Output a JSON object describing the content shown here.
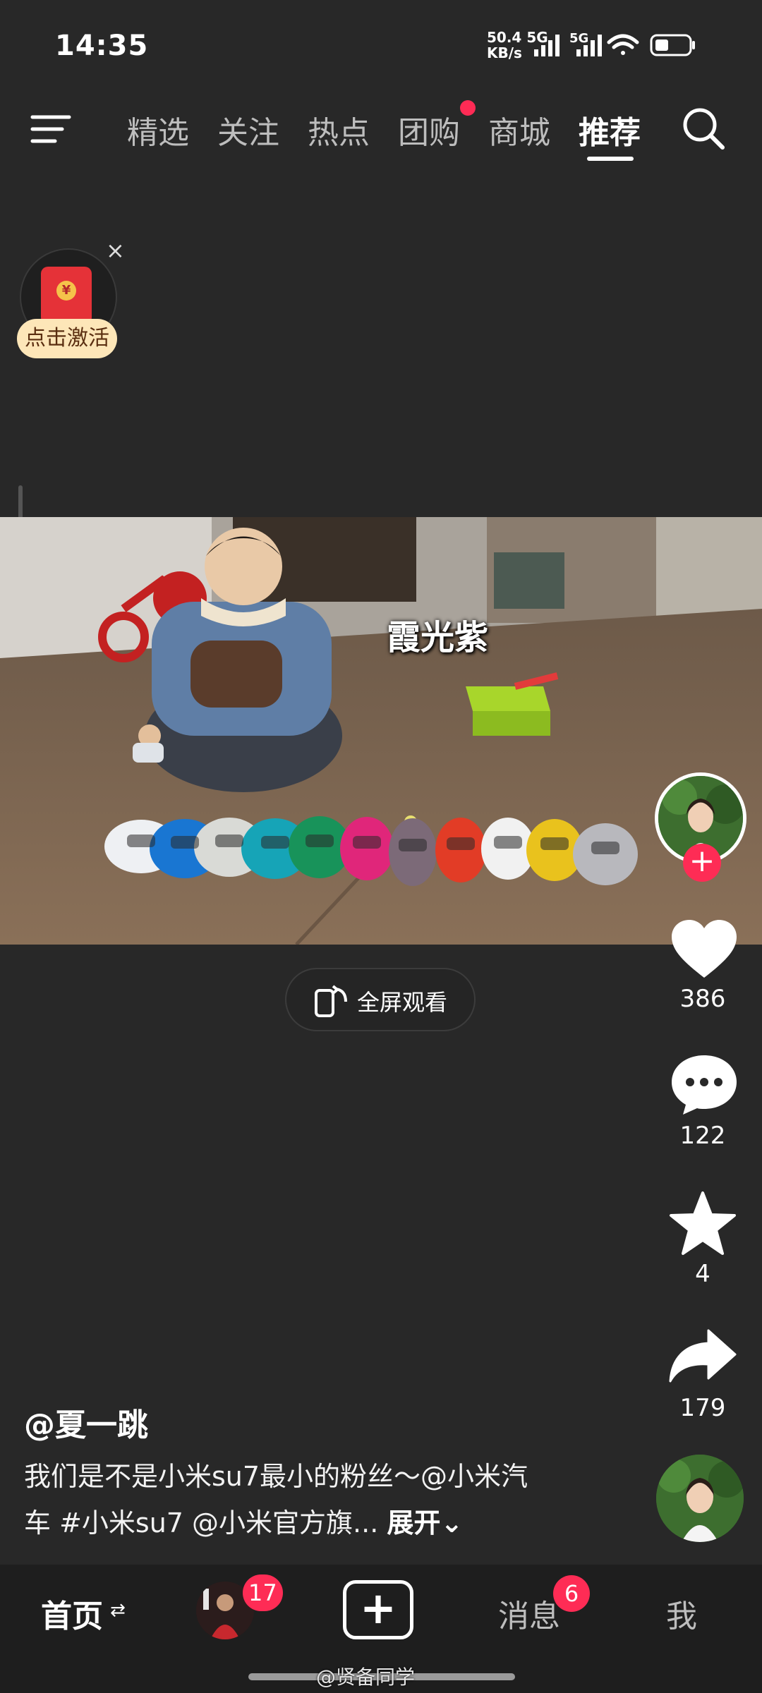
{
  "status_bar": {
    "time": "14:35",
    "speed_value": "50.4",
    "speed_unit": "KB/s",
    "network1": "5G",
    "network2": "5G"
  },
  "top_nav": {
    "tabs": [
      "精选",
      "关注",
      "热点",
      "团购",
      "商城",
      "推荐"
    ],
    "active_tab": "推荐",
    "icons": {
      "menu": "menu-icon",
      "search": "search-icon"
    }
  },
  "red_packet": {
    "label": "点击激活",
    "close": "×",
    "seal": "¥"
  },
  "video": {
    "caption": "霞光紫",
    "fullscreen_label": "全屏观看"
  },
  "right_rail": {
    "follow": "+",
    "likes": "386",
    "comments": "122",
    "favorites": "4",
    "shares": "179"
  },
  "post": {
    "author": "@夏一跳",
    "desc_line1": "我们是不是小米su7最小的粉丝～@小米汽",
    "desc_line2": "车 #小米su7 @小米官方旗...",
    "expand": "展开"
  },
  "bottom_bar": {
    "home": "首页",
    "friends_badge": "17",
    "create": "+",
    "messages": "消息",
    "messages_badge": "6",
    "me": "我"
  },
  "watermark": "@贤备同学",
  "colors": {
    "background": "#282828",
    "accent": "#fe2c55",
    "badge": "#fe2c55"
  }
}
